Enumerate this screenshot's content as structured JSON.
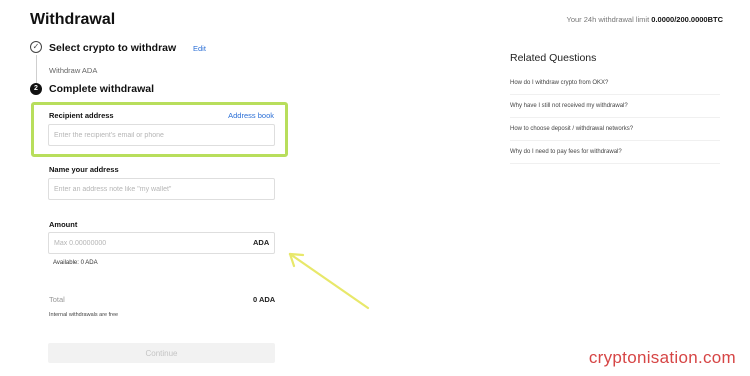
{
  "header": {
    "title": "Withdrawal",
    "limit_label": "Your 24h withdrawal limit",
    "limit_value": "0.0000/200.0000BTC"
  },
  "steps": {
    "step1": {
      "icon": "✓",
      "label": "Select crypto to withdraw",
      "edit": "Edit",
      "sub": "Withdraw ADA"
    },
    "step2": {
      "number": "2",
      "label": "Complete withdrawal"
    }
  },
  "form": {
    "recipient": {
      "label": "Recipient address",
      "link": "Address book",
      "placeholder": "Enter the recipient's email or phone",
      "value": ""
    },
    "name": {
      "label": "Name your address",
      "placeholder": "Enter an address note like \"my wallet\"",
      "value": ""
    },
    "amount": {
      "label": "Amount",
      "placeholder": "Max 0.00000000",
      "unit": "ADA",
      "value": "",
      "available": "Available:  0 ADA"
    },
    "total": {
      "label": "Total",
      "value": "0 ADA"
    },
    "note": "Internal withdrawals are free",
    "continue": "Continue"
  },
  "related": {
    "title": "Related Questions",
    "items": [
      "How do I withdraw crypto from OKX?",
      "Why have I still not received my withdrawal?",
      "How to choose deposit / withdrawal networks?",
      "Why do I need to pay fees for withdrawal?"
    ]
  },
  "annotation": {
    "highlight_color": "#b8de5c",
    "arrow_color": "#e8e86a"
  },
  "watermark": "cryptonisation.com"
}
